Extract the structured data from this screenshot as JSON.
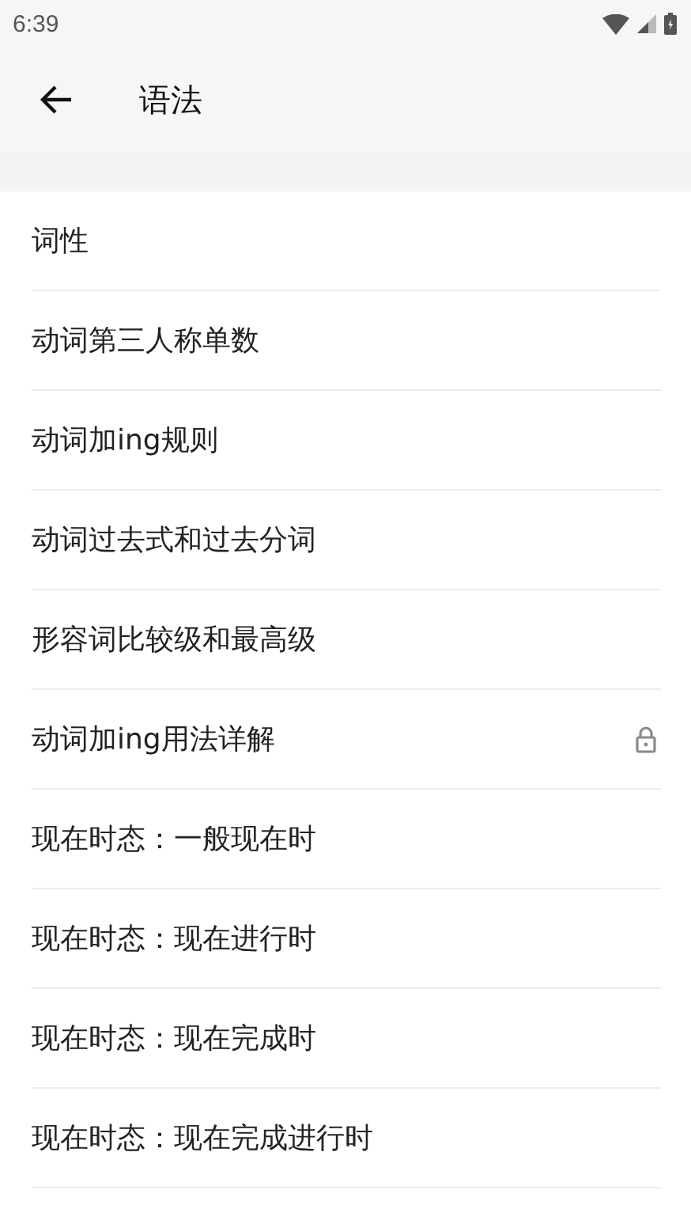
{
  "status_bar": {
    "time": "6:39"
  },
  "app_bar": {
    "title": "语法"
  },
  "items": [
    {
      "label": "词性",
      "locked": false
    },
    {
      "label": "动词第三人称单数",
      "locked": false
    },
    {
      "label": "动词加ing规则",
      "locked": false
    },
    {
      "label": "动词过去式和过去分词",
      "locked": false
    },
    {
      "label": "形容词比较级和最高级",
      "locked": false
    },
    {
      "label": "动词加ing用法详解",
      "locked": true
    },
    {
      "label": "现在时态：一般现在时",
      "locked": false
    },
    {
      "label": "现在时态：现在进行时",
      "locked": false
    },
    {
      "label": "现在时态：现在完成时",
      "locked": false
    },
    {
      "label": "现在时态：现在完成进行时",
      "locked": false
    }
  ]
}
